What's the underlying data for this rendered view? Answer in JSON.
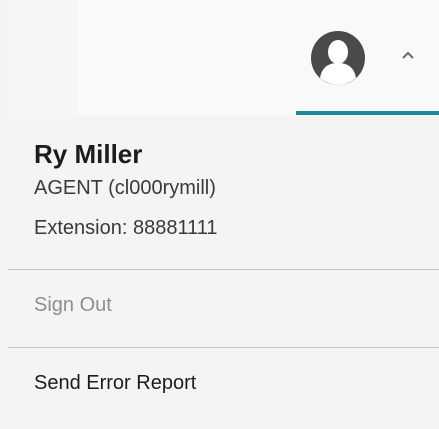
{
  "header": {
    "avatar_icon": "user-avatar-icon",
    "caret_icon": "chevron-up-icon",
    "accent_color": "#1e8a96"
  },
  "user": {
    "name": "Ry Miller",
    "role": "AGENT (cl000rymill)",
    "extension": "Extension: 88881111"
  },
  "menu": {
    "sign_out": "Sign Out",
    "send_error_report": "Send Error Report"
  }
}
